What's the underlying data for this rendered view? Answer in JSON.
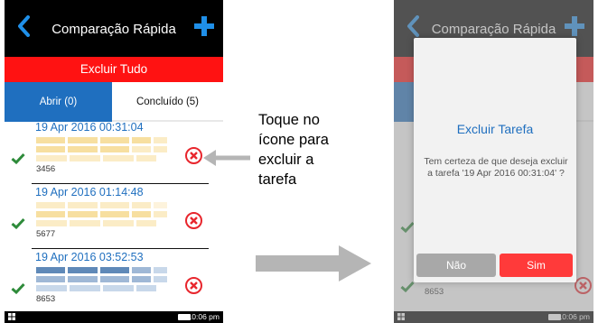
{
  "app": {
    "title": "Comparação Rápida",
    "delete_all": "Excluir Tudo",
    "tabs": [
      {
        "label": "Abrir (0)",
        "active": true
      },
      {
        "label": "Concluído (5)",
        "active": false
      }
    ]
  },
  "tasks": [
    {
      "date": "19 Apr 2016 00:31:04",
      "value": "3456",
      "palette": "yellow"
    },
    {
      "date": "19 Apr 2016 01:14:48",
      "value": "5677",
      "palette": "yellow"
    },
    {
      "date": "19 Apr 2016 03:52:53",
      "value": "8653",
      "palette": "blue"
    }
  ],
  "status_bar": {
    "time": "10:06 pm"
  },
  "annotation": {
    "lines": [
      "Toque no",
      "ícone para",
      "excluir a",
      "tarefa"
    ]
  },
  "dialog": {
    "title": "Excluir Tarefa",
    "message": "Tem certeza de que deseja excluir a tarefa '19 Apr 2016 00:31:04' ?",
    "no_label": "Não",
    "yes_label": "Sim"
  },
  "colors": {
    "accent_blue": "#1f6fbf",
    "delete_red": "#ff1212",
    "check_green": "#2e8b3a",
    "swatch_yellow": "#f7dfa0",
    "swatch_blue": "#9fb8d6"
  },
  "icons": {
    "back": "chevron-left-icon",
    "add": "plus-icon",
    "check": "check-icon",
    "delete": "circle-x-icon",
    "arrow_pointer": "arrow-left-icon",
    "arrow_next": "arrow-right-icon"
  }
}
